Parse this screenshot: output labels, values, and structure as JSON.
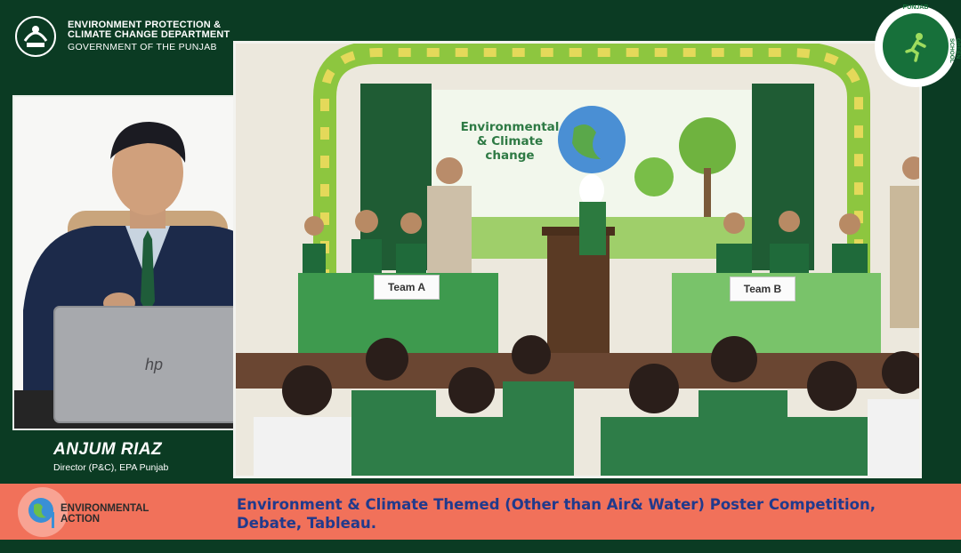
{
  "header": {
    "org_line1": "ENVIRONMENT PROTECTION &",
    "org_line2": "CLIMATE CHANGE DEPARTMENT",
    "org_line3": "GOVERNMENT OF THE PUNJAB",
    "logo_icon": "government-crest-icon"
  },
  "badge": {
    "text_top": "PUNJAB",
    "text_side": "GREEN SCHOOL",
    "icon": "running-figure-icon"
  },
  "speaker": {
    "name": "ANJUM RIAZ",
    "title": "Director (P&C), EPA Punjab",
    "laptop_brand": "hp"
  },
  "event": {
    "backdrop_line1": "Environmental",
    "backdrop_line2": "& Climate",
    "backdrop_line3": "change",
    "team_a": "Team A",
    "team_b": "Team B"
  },
  "ticker": {
    "brand_line1": "ENVIRONMENTAL",
    "brand_line2": "ACTION",
    "text_line1": "Environment & Climate Themed (Other than Air& Water) Poster Competition,",
    "text_line2": "Debate, Tableau."
  },
  "colors": {
    "frame_green": "#0b3b23",
    "ticker_salmon": "#f1715a",
    "ticker_text": "#213a8c",
    "accent_green": "#17703a"
  }
}
